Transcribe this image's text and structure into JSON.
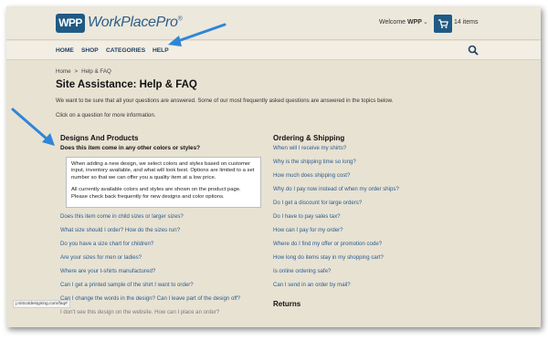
{
  "header": {
    "logo_badge": "WPP",
    "logo_text": "WorkPlacePro",
    "logo_reg": "®",
    "welcome_prefix": "Welcome",
    "welcome_user": "WPP",
    "cart_count": "14 items"
  },
  "nav": {
    "items": [
      "HOME",
      "SHOP",
      "CATEGORIES",
      "HELP"
    ]
  },
  "breadcrumb": [
    "Home",
    ">",
    "Help & FAQ"
  ],
  "page": {
    "title": "Site Assistance: Help & FAQ",
    "intro": "We want to be sure that all your questions are answered. Some of our most frequently asked questions are answered in the topics below.",
    "instruction": "Click on a question for more information."
  },
  "designs": {
    "title": "Designs And Products",
    "active_question": "Does this item come in any other colors or styles?",
    "answer_p1": "When adding a new design, we select colors and styles based on customer input, inventory available, and what will look best. Options are limited to a set number so that we can offer you a quality item at a low price.",
    "answer_p2": "All currently available colors and styles are shown on the product page. Please check back frequently for new designs and color options.",
    "questions": [
      "Does this item come in child sizes or larger sizes?",
      "What size should I order? How do the sizes run?",
      "Do you have a size chart for children?",
      "Are your sizes for men or ladies?",
      "Where are your t-shirts manufactured?",
      "Can I get a printed sample of the shirt I want to order?",
      "Can I change the words in the design? Can I leave part of the design off?",
      "I don't see this design on the website. How can I place an order?"
    ]
  },
  "ordering": {
    "title": "Ordering & Shipping",
    "questions": [
      "When will I receive my shirts?",
      "Why is the shipping time so long?",
      "How much does shipping cost?",
      "Why do I pay now instead of when my order ships?",
      "Do I get a discount for large orders?",
      "Do I have to pay sales tax?",
      "How can I pay for my order?",
      "Where do I find my offer or promotion code?",
      "How long do items stay in my shopping cart?",
      "Is online ordering safe?",
      "Can I send in an order by mail?"
    ]
  },
  "returns": {
    "title": "Returns"
  },
  "status_url": "j.mitcotdesigning.com/faq#"
}
